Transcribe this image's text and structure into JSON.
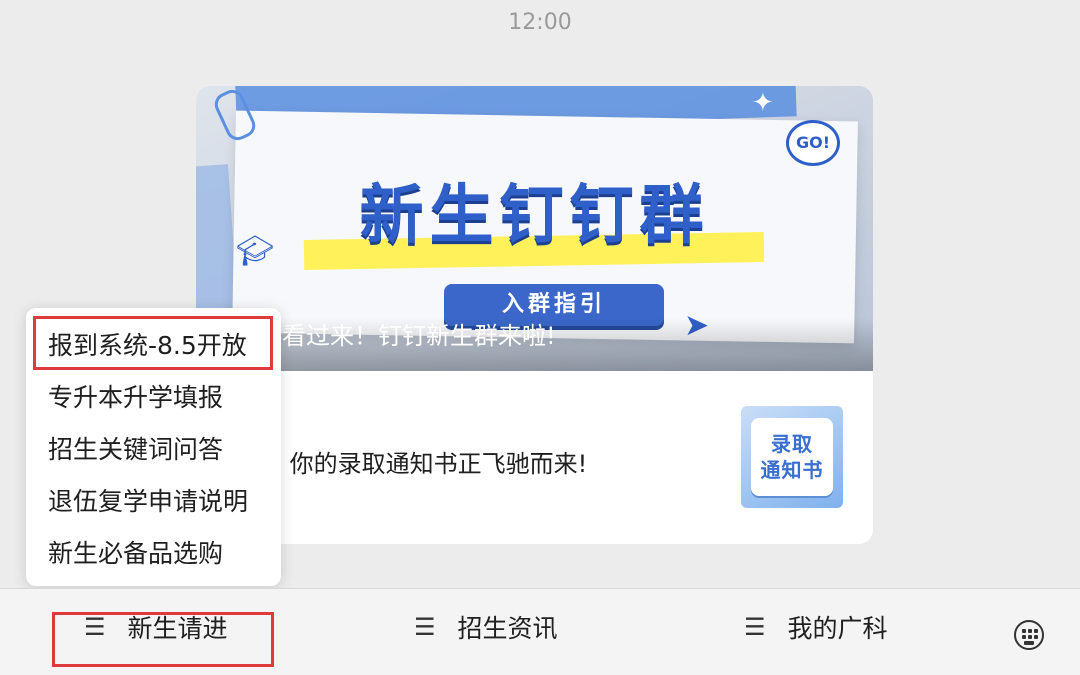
{
  "status_time": "12:00",
  "article": {
    "cover": {
      "title": "新生钉钉群",
      "button_label": "入群指引",
      "go_badge": "GO!",
      "caption": "学看过来！钉钉新生群来啦!"
    },
    "summary": "！ 你的录取通知书正飞驰而来!",
    "thumbnail": {
      "line1": "录取",
      "line2": "通知书"
    }
  },
  "popup_menu": {
    "items": [
      "报到系统-8.5开放",
      "专升本升学填报",
      "招生关键词问答",
      "退伍复学申请说明",
      "新生必备品选购"
    ]
  },
  "bottom_menu": {
    "menu_icon": "☰",
    "tabs": [
      "新生请进",
      "招生资讯",
      "我的广科"
    ],
    "keyboard_icon": "keyboard-icon"
  },
  "colors": {
    "highlight": "#e0393e",
    "brand_blue": "#2f5fc8"
  }
}
